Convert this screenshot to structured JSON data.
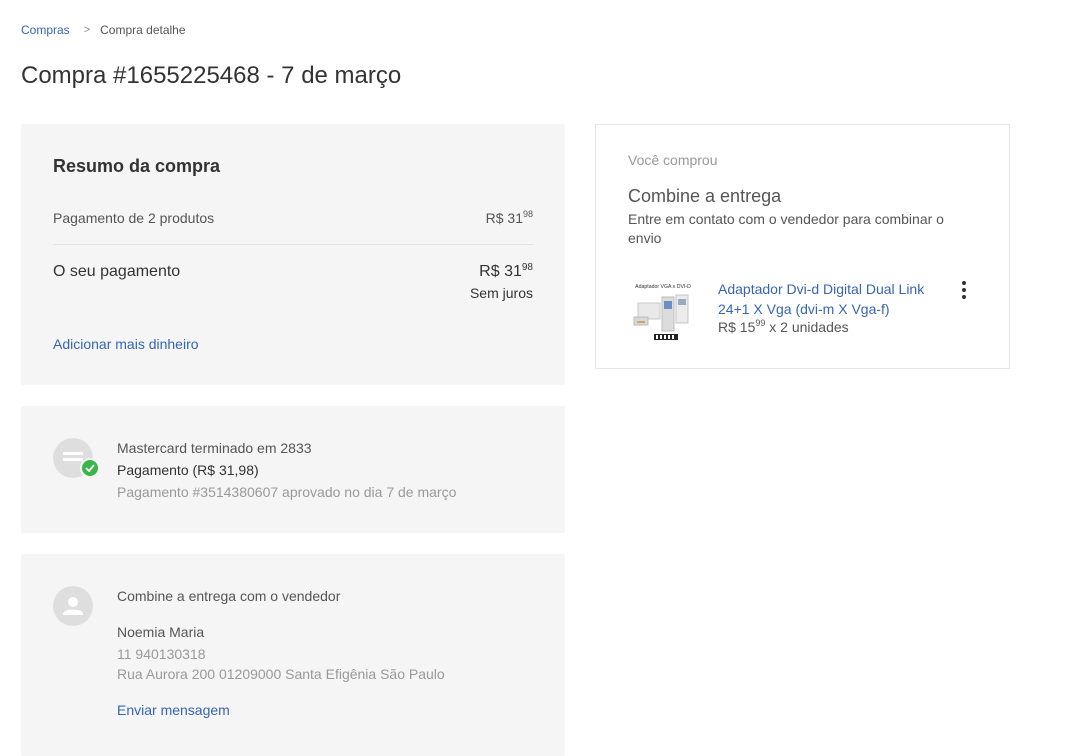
{
  "breadcrumb": {
    "root": "Compras",
    "separator": ">",
    "current": "Compra detalhe"
  },
  "page": {
    "title": "Compra #1655225468 - 7 de março"
  },
  "summary": {
    "title": "Resumo da compra",
    "products_label": "Pagamento de 2 produtos",
    "products_value_int": "R$ 31",
    "products_value_cents": "98",
    "payment_label": "O seu pagamento",
    "payment_value_int": "R$ 31",
    "payment_value_cents": "98",
    "interest_note": "Sem juros",
    "add_money_link": "Adicionar mais dinheiro"
  },
  "payment": {
    "icon": "credit-card-icon",
    "status_icon": "check-icon",
    "status_color": "#39b54a",
    "card": "Mastercard terminado em 2833",
    "amount": "Pagamento (R$ 31,98)",
    "approval": "Pagamento #3514380607 aprovado no dia 7 de março"
  },
  "delivery": {
    "icon": "user-icon",
    "heading": "Combine a entrega com o vendedor",
    "seller_name": "Noemia Maria",
    "phone": "11 940130318",
    "address": "Rua Aurora 200 01209000 Santa Efigênia São Paulo",
    "message_link": "Enviar mensagem"
  },
  "order": {
    "you_bought": "Você comprou",
    "combine_title": "Combine a entrega",
    "combine_desc": "Entre em contato com o vendedor para combinar o envio",
    "product": {
      "thumbnail_caption": "Adaptador VGA x DVI-D",
      "title": "Adaptador Dvi-d Digital Dual Link 24+1 X Vga (dvi-m X Vga-f)",
      "price_int": "R$ 15",
      "price_cents": "99",
      "quantity": "x 2 unidades"
    },
    "menu_icon": "more-vertical-icon"
  },
  "colors": {
    "link": "#3665b4",
    "card_bg": "#f5f5f5",
    "success": "#39b54a"
  }
}
